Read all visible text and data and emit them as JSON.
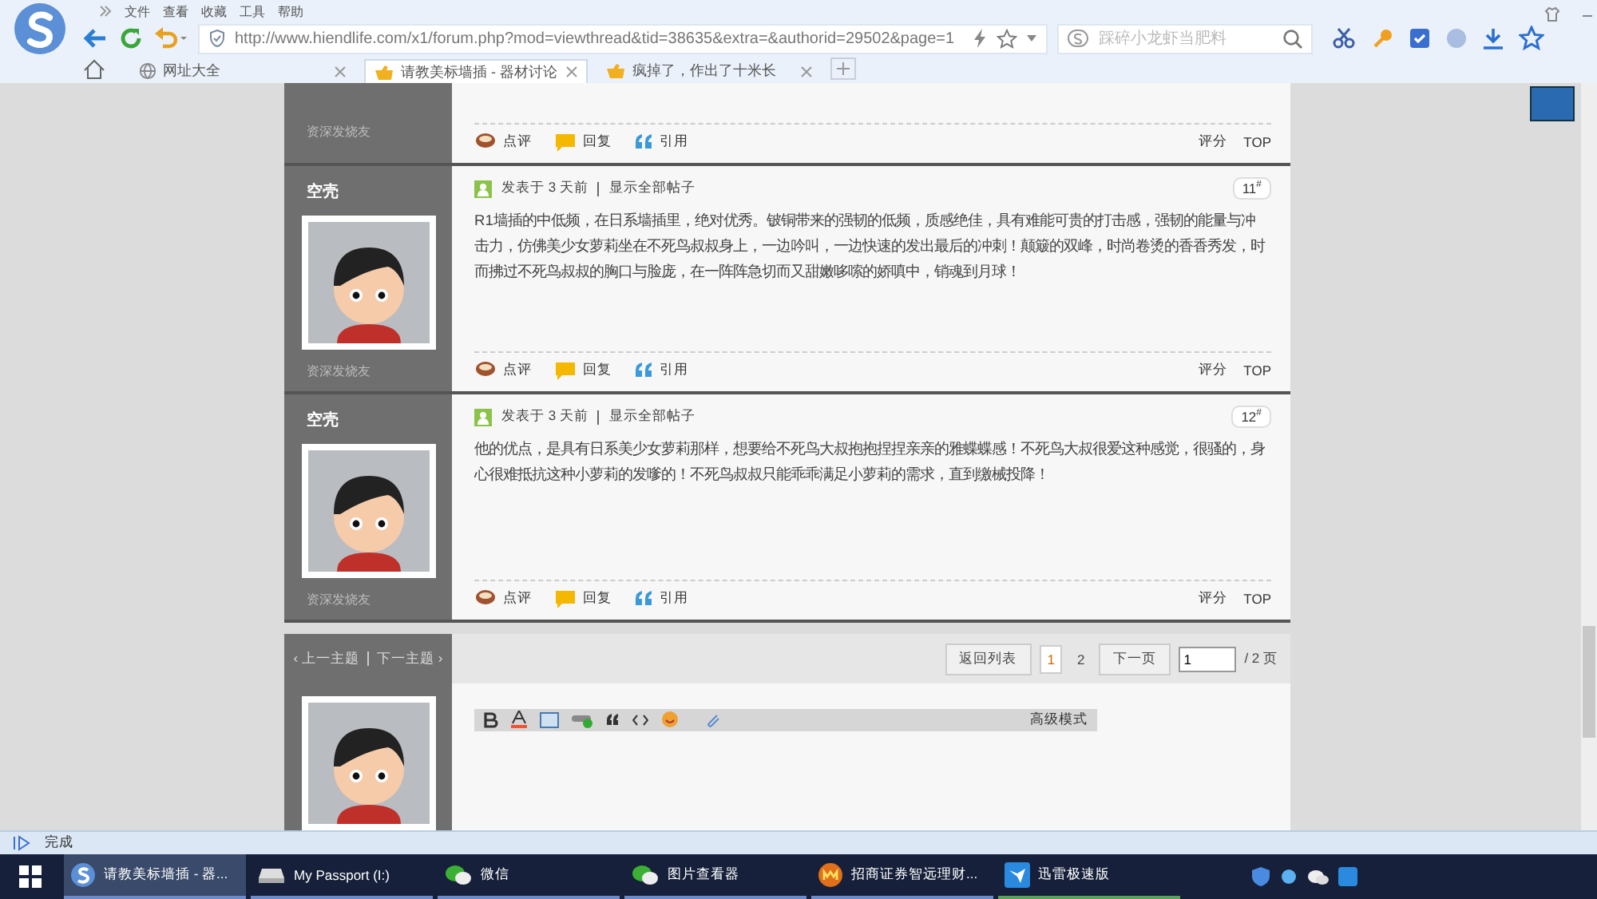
{
  "browser": {
    "menu": [
      "文件",
      "查看",
      "收藏",
      "工具",
      "帮助"
    ],
    "url": "http://www.hiendlife.com/x1/forum.php?mod=viewthread&tid=38635&extra=&authorid=29502&page=1",
    "search": {
      "placeholder": "踩碎小龙虾当肥料"
    },
    "tabs": [
      {
        "label": "网址大全",
        "selected": false
      },
      {
        "label": "请教美标墙插 - 器材讨论",
        "selected": true
      },
      {
        "label": "疯掉了，作出了十米长",
        "selected": false
      }
    ]
  },
  "thread": {
    "partial_post": {
      "rank": "资深发烧友",
      "actions": [
        "点评",
        "回复",
        "引用"
      ],
      "right_actions": [
        "评分",
        "TOP"
      ]
    },
    "posts": [
      {
        "author": "空壳",
        "rank": "资深发烧友",
        "posted": "发表于 3 天前",
        "show_all": "显示全部帖子",
        "floor": "11$^{#}$",
        "body": "R1墙插的中低频，在日系墙插里，绝对优秀。铍铜带来的强韧的低频，质感绝佳，具有难能可贵的打击感，强韧的能量与冲击力，仿佛美少女萝莉坐在不死鸟叔叔身上，一边吟叫，一边快速的发出最后的冲刺！颠簸的双峰，时尚卷烫的香香秀发，时而拂过不死鸟叔叔的胸口与脸庞，在一阵阵急切而又甜嫩哆嗦的娇嗔中，销魂到月球！",
        "actions": [
          "点评",
          "回复",
          "引用"
        ],
        "right_actions": [
          "评分",
          "TOP"
        ]
      },
      {
        "author": "空壳",
        "rank": "资深发烧友",
        "posted": "发表于 3 天前",
        "show_all": "显示全部帖子",
        "floor": "12$^{#}$",
        "body": "他的优点，是具有日系美少女萝莉那样，想要给不死鸟大叔抱抱捏捏亲亲的雅蝶蝶感！不死鸟大叔很爱这种感觉，很骚的，身心很难抵抗这种小萝莉的发嗲的！不死鸟叔叔只能乖乖满足小萝莉的需求，直到缴械投降！",
        "actions": [
          "点评",
          "回复",
          "引用"
        ],
        "right_actions": [
          "评分",
          "TOP"
        ]
      }
    ],
    "nav": {
      "prev": "‹ 上一主题",
      "next": "下一主题 ›"
    },
    "pager": {
      "back": "返回列表",
      "pages": [
        {
          "label": "1",
          "selected": true
        },
        {
          "label": "2",
          "selected": false
        }
      ],
      "next": "下一页",
      "page_input": "1",
      "total": "/ 2 页"
    },
    "editor": {
      "mode": "高级模式"
    }
  },
  "status_bar": {
    "text": "完成"
  },
  "taskbar": {
    "items": [
      {
        "label": "请教美标墙插 - 器...",
        "kind": "browser",
        "selected": true
      },
      {
        "label": "My Passport (I:)",
        "kind": "drive",
        "selected": false
      },
      {
        "label": "微信",
        "kind": "chat",
        "selected": false
      },
      {
        "label": "图片查看器",
        "kind": "chat",
        "selected": false
      },
      {
        "label": "招商证券智远理财...",
        "kind": "finance",
        "selected": false
      },
      {
        "label": "迅雷极速版",
        "kind": "download",
        "selected": false
      }
    ]
  }
}
